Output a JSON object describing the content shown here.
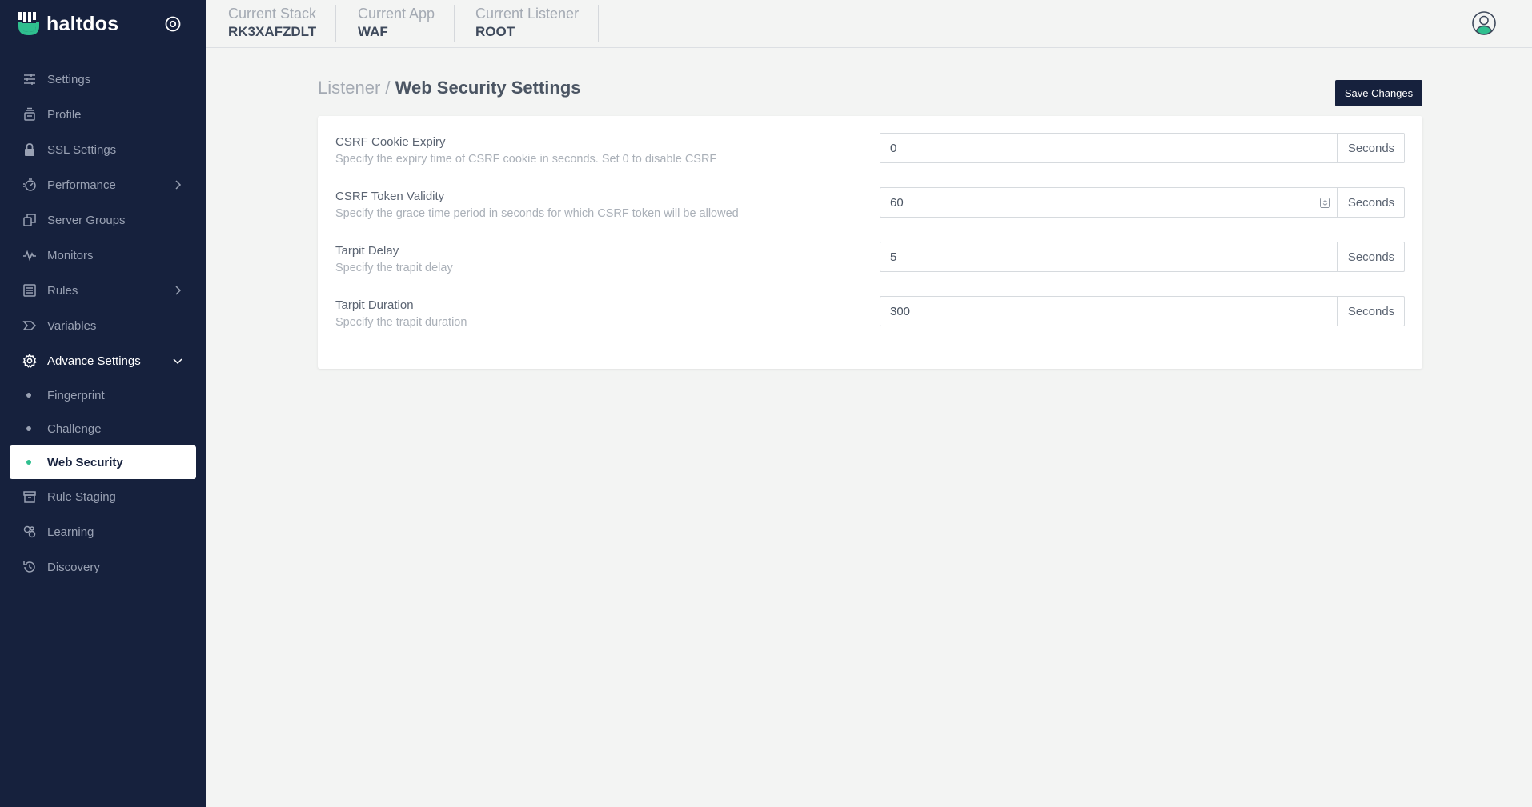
{
  "brand": {
    "name": "haltdos",
    "accent": "#2fbf8f"
  },
  "header": {
    "contexts": [
      {
        "label": "Current Stack",
        "value": "RK3XAFZDLT"
      },
      {
        "label": "Current App",
        "value": "WAF"
      },
      {
        "label": "Current Listener",
        "value": "ROOT"
      }
    ]
  },
  "sidebar": {
    "items": [
      {
        "label": "Settings",
        "icon": "sliders-icon"
      },
      {
        "label": "Profile",
        "icon": "stack-icon"
      },
      {
        "label": "SSL Settings",
        "icon": "lock-icon"
      },
      {
        "label": "Performance",
        "icon": "gauge-icon"
      },
      {
        "label": "Server Groups",
        "icon": "copy-icon"
      },
      {
        "label": "Monitors",
        "icon": "pulse-icon"
      },
      {
        "label": "Rules",
        "icon": "list-icon"
      },
      {
        "label": "Variables",
        "icon": "tag-icon"
      },
      {
        "label": "Advance Settings",
        "icon": "gear-icon"
      },
      {
        "label": "Rule Staging",
        "icon": "archive-icon"
      },
      {
        "label": "Learning",
        "icon": "learning-icon"
      },
      {
        "label": "Discovery",
        "icon": "history-icon"
      }
    ],
    "subitems": [
      {
        "label": "Fingerprint"
      },
      {
        "label": "Challenge"
      },
      {
        "label": "Web Security"
      }
    ]
  },
  "page": {
    "breadcrumb_parent": "Listener /",
    "title": "Web Security Settings",
    "save_label": "Save Changes"
  },
  "settings": [
    {
      "label": "CSRF Cookie Expiry",
      "description": "Specify the expiry time of CSRF cookie in seconds. Set 0 to disable CSRF",
      "value": "0",
      "unit": "Seconds"
    },
    {
      "label": "CSRF Token Validity",
      "description": "Specify the grace time period in seconds for which CSRF token will be allowed",
      "value": "60",
      "unit": "Seconds"
    },
    {
      "label": "Tarpit Delay",
      "description": "Specify the trapit delay",
      "value": "5",
      "unit": "Seconds"
    },
    {
      "label": "Tarpit Duration",
      "description": "Specify the trapit duration",
      "value": "300",
      "unit": "Seconds"
    }
  ]
}
